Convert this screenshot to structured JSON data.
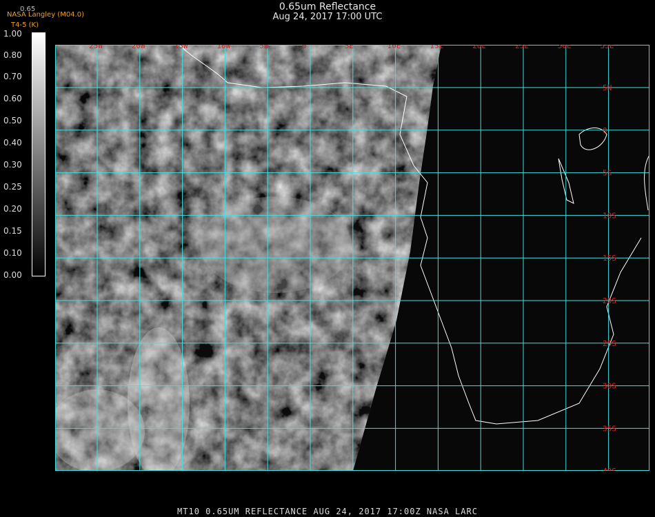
{
  "header": {
    "title": "0.65um Reflectance",
    "subtitle": "Aug 24, 2017 17:00 UTC",
    "brand": "NASA Langley (M04.0)",
    "sub_brand": "T4-5 (K)",
    "ghost_label": "0.65"
  },
  "colorbar": {
    "labels": [
      "1.00",
      "0.80",
      "0.70",
      "0.60",
      "0.50",
      "0.40",
      "0.30",
      "0.25",
      "0.20",
      "0.15",
      "0.10",
      "0.00"
    ]
  },
  "grid": {
    "lon_labels": [
      "25W",
      "20W",
      "15W",
      "10W",
      "5W",
      "0",
      "5E",
      "10E",
      "15E",
      "20E",
      "25E",
      "30E",
      "35E"
    ],
    "lat_labels": [
      "5N",
      "0",
      "5S",
      "10S",
      "15S",
      "20S",
      "25S",
      "30S",
      "35S",
      "40S"
    ]
  },
  "footer": {
    "text": "MT10  0.65UM REFLECTANCE   AUG 24, 2017 17:00Z   NASA LARC"
  },
  "colors": {
    "grid": "#40e0e0",
    "labels": "#e02020",
    "brand": "#f0a020"
  }
}
